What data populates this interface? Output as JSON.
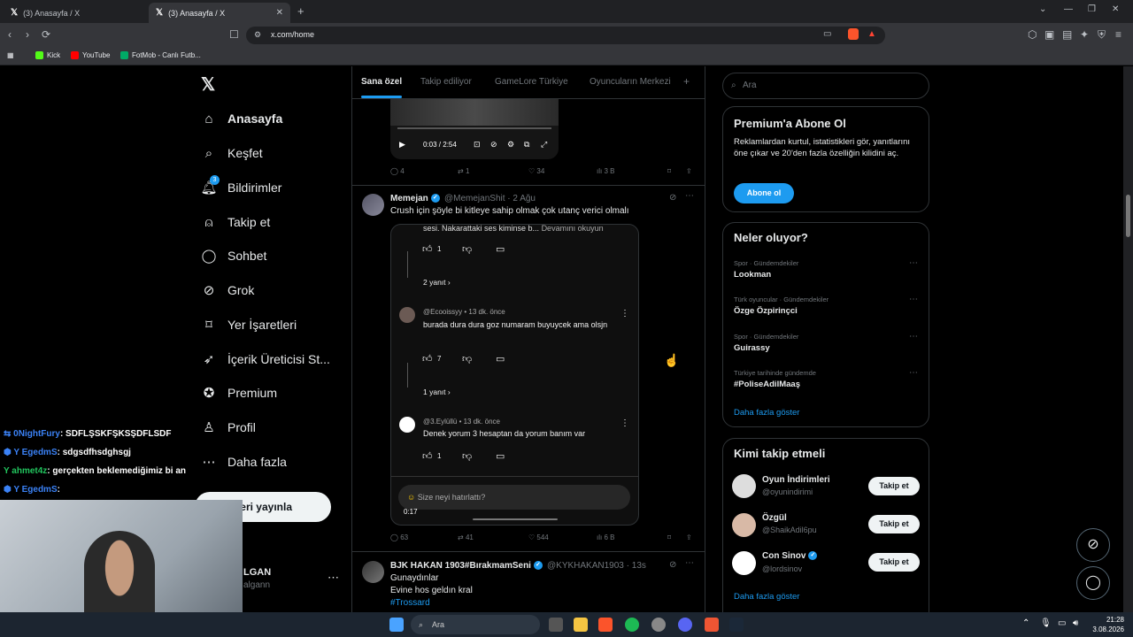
{
  "browser": {
    "tabs": [
      {
        "label": "(3) Anasayfa / X"
      },
      {
        "label": "(3) Anasayfa / X"
      }
    ],
    "url": "x.com/home",
    "bookmarks": [
      {
        "label": "Kick"
      },
      {
        "label": "YouTube"
      },
      {
        "label": "FotMob - Canlı Futb..."
      }
    ]
  },
  "nav": {
    "items": [
      {
        "label": "Anasayfa",
        "icon": "home-icon"
      },
      {
        "label": "Keşfet",
        "icon": "search-icon"
      },
      {
        "label": "Bildirimler",
        "icon": "bell-icon",
        "badge": "3"
      },
      {
        "label": "Takip et",
        "icon": "follow-icon"
      },
      {
        "label": "Sohbet",
        "icon": "chat-icon"
      },
      {
        "label": "Grok",
        "icon": "grok-icon"
      },
      {
        "label": "Yer İşaretleri",
        "icon": "bookmark-icon"
      },
      {
        "label": "İçerik Üreticisi St...",
        "icon": "rocket-icon"
      },
      {
        "label": "Premium",
        "icon": "verified-icon"
      },
      {
        "label": "Profil",
        "icon": "profile-icon"
      },
      {
        "label": "Daha fazla",
        "icon": "more-icon"
      }
    ],
    "post_button": "deri yayınla",
    "account_name": "LGAN",
    "account_handle": "algann"
  },
  "feed": {
    "tabs": [
      "Sana özel",
      "Takip ediliyor",
      "GameLore Türkiye",
      "Oyuncuların Merkezi"
    ],
    "video_time": "0:03 / 2:54",
    "post1_actions": {
      "replies": "4",
      "reposts": "1",
      "likes": "34",
      "views": "3 B"
    },
    "post2": {
      "name": "Memejan",
      "handle": "@MemejanShit",
      "time": "2 Ağu",
      "text": "Crush için şöyle bi kitleye sahip olmak çok utanç verici olmalı",
      "embed": {
        "top_text": "sesi. Nakarattaki ses kiminse b...",
        "more": "Devamını okuyun",
        "c1_likes": "1",
        "c1_replies": "2 yanıt",
        "c2_handle": "@Ecooissyy",
        "c2_time": "13 dk. önce",
        "c2_text": "burada dura dura goz numaram buyuycek ama olsjn",
        "c2_likes": "7",
        "c2_replies": "1 yanıt",
        "c3_handle": "@3.Eylüllü",
        "c3_time": "13 dk. önce",
        "c3_text": "Denek yorum 3 hesaptan da yorum banım var",
        "c3_likes": "1",
        "reply_placeholder": "Size neyi hatırlattı?",
        "duration": "0:17"
      },
      "actions": {
        "replies": "63",
        "reposts": "41",
        "likes": "544",
        "views": "6 B"
      }
    },
    "post3": {
      "name": "BJK HAKAN 1903#BırakmamSeni",
      "handle": "@KYKHAKAN1903",
      "time": "13s",
      "line1": "Gunaydınlar",
      "line2": "Evine hos geldın kral",
      "line3": "#Trossard"
    }
  },
  "sidebar": {
    "search_placeholder": "Ara",
    "premium": {
      "title": "Premium'a Abone Ol",
      "text": "Reklamlardan kurtul, istatistikleri gör, yanıtlarını öne çıkar ve 20'den fazla özelliğin kilidini aç.",
      "button": "Abone ol"
    },
    "trends": {
      "title": "Neler oluyor?",
      "items": [
        {
          "meta": "Spor · Gündemdekiler",
          "name": "Lookman"
        },
        {
          "meta": "Türk oyuncular · Gündemdekiler",
          "name": "Özge Özpirinçci"
        },
        {
          "meta": "Spor · Gündemdekiler",
          "name": "Guirassy"
        },
        {
          "meta": "Türkiye tarihinde gündemde",
          "name": "#PoliseAdilMaaş"
        }
      ],
      "more": "Daha fazla göster"
    },
    "who": {
      "title": "Kimi takip etmeli",
      "items": [
        {
          "name": "Oyun İndirimleri",
          "handle": "@oyunindirimi"
        },
        {
          "name": "Özgül",
          "handle": "@ShaikAdil6pu"
        },
        {
          "name": "Con Sinov",
          "handle": "@lordsinov"
        }
      ],
      "follow": "Takip et",
      "more": "Daha fazla göster"
    }
  },
  "stream_chat": [
    {
      "user": "0NightFury",
      "msg": ": SDFLŞSKFŞKSŞDFLSDF",
      "color": "#3b82f6"
    },
    {
      "user": "EgedmS",
      "msg": ": sdgsdfhsdghsgj",
      "color": "#3b82f6"
    },
    {
      "user": "ahmet4z",
      "msg": ": gerçekten beklemediğimiz bi an",
      "color": "#22c55e"
    },
    {
      "user": "EgedmS",
      "msg": ":",
      "color": "#3b82f6"
    }
  ],
  "taskbar": {
    "search": "Ara",
    "time": "21:28",
    "date": "3.08.2026"
  },
  "colors": {
    "accent": "#1d9bf0",
    "bg": "#000000",
    "border": "#2f3336"
  }
}
